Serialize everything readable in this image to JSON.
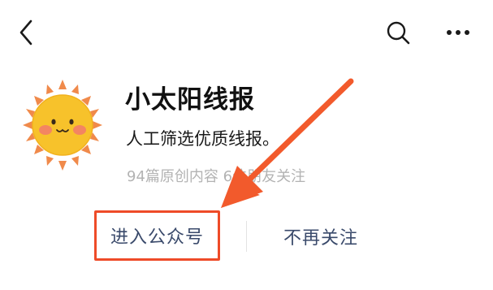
{
  "nav": {
    "back_icon": "chevron-left-icon",
    "search_icon": "search-icon",
    "more_icon": "more-dots-icon"
  },
  "account": {
    "avatar_icon": "sun-avatar-icon",
    "name": "小太阳线报",
    "description": "人工筛选优质线报。",
    "stats": "94篇原创内容  6位朋友关注"
  },
  "actions": {
    "enter_label": "进入公众号",
    "unfollow_label": "不再关注"
  },
  "colors": {
    "accent": "#ee4b28",
    "action_text": "#3a4a6b",
    "muted_text": "#b3b3b3",
    "sun_fill": "#f7c22b",
    "sun_rays": "#f08a4b"
  }
}
